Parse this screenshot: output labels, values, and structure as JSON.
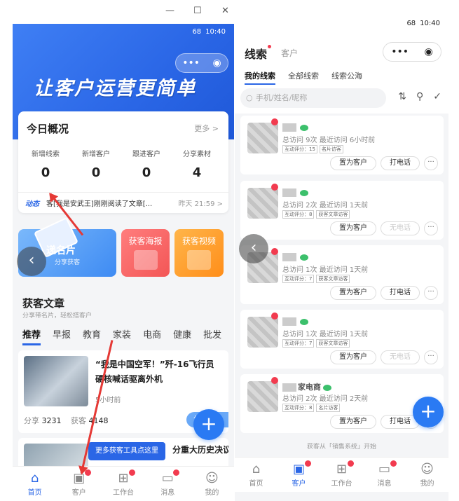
{
  "window": {
    "minimize": "—",
    "maximize": "☐",
    "close": "✕"
  },
  "left": {
    "status_time": "10:40",
    "status_battery": "68",
    "capsule": {
      "more": "•••",
      "target": "◉"
    },
    "slogan": "让客户运营更简单",
    "overview": {
      "title": "今日概况",
      "more": "更多 >",
      "stats": [
        {
          "label": "新增线索",
          "value": "0"
        },
        {
          "label": "新增客户",
          "value": "0"
        },
        {
          "label": "跟进客户",
          "value": "0"
        },
        {
          "label": "分享素材",
          "value": "4"
        }
      ],
      "feed_tag": "动态",
      "feed_text": "客[我是安武王]刚刚阅读了文章[...",
      "feed_time": "昨天 21:59 >"
    },
    "tiles": {
      "card_title": "递名片",
      "card_sub": "分享获客",
      "poster": "获客海报",
      "video": "获客视频"
    },
    "section": {
      "title": "获客文章",
      "subtitle": "分享带名片，轻松搭客户"
    },
    "tabs": [
      "推荐",
      "早报",
      "教育",
      "家装",
      "电商",
      "健康",
      "批发"
    ],
    "article": {
      "title": "“我是中国空军！”歼-16飞行员硬核喊话驱离外机",
      "time": "5小时前",
      "share_label": "分享",
      "share_count": "3231",
      "get_label": "获客",
      "get_count": "4148",
      "share_btn": "分享"
    },
    "article2_title": "分重大历史决议",
    "tooltip": "更多获客工具点这里",
    "nav": [
      {
        "icon": "⌂",
        "label": "首页"
      },
      {
        "icon": "▣",
        "label": "客户"
      },
      {
        "icon": "⊞",
        "label": "工作台"
      },
      {
        "icon": "▭",
        "label": "消息"
      },
      {
        "icon": "☺",
        "label": "我的"
      }
    ]
  },
  "right": {
    "status_time": "10:40",
    "status_battery": "68",
    "title": "线索",
    "title2": "客户",
    "capsule": {
      "more": "•••",
      "target": "◉"
    },
    "tabs": [
      "我的线索",
      "全部线索",
      "线索公海"
    ],
    "search_placeholder": "手机/姓名/昵称",
    "tools": {
      "sort": "⇅",
      "filter": "⚲",
      "check": "✓"
    },
    "leads": [
      {
        "name": "",
        "visits": "总访问 9次",
        "last": "最近访问 6小时前",
        "chips": [
          "互动评分：15",
          "名片访客"
        ],
        "set_btn": "置为客户",
        "call_btn": "打电话",
        "call_disabled": false,
        "more": "···"
      },
      {
        "name": "",
        "visits": "总访问 2次",
        "last": "最近访问 1天前",
        "chips": [
          "互动评分：8",
          "获客文章访客"
        ],
        "set_btn": "置为客户",
        "call_btn": "无电话",
        "call_disabled": true,
        "more": "···"
      },
      {
        "name": "",
        "visits": "总访问 1次",
        "last": "最近访问 1天前",
        "chips": [
          "互动评分：7",
          "获客文章访客"
        ],
        "set_btn": "置为客户",
        "call_btn": "打电话",
        "call_disabled": false,
        "more": "···"
      },
      {
        "name": "",
        "visits": "总访问 1次",
        "last": "最近访问 1天前",
        "chips": [
          "互动评分：7",
          "获客文章访客"
        ],
        "set_btn": "置为客户",
        "call_btn": "无电话",
        "call_disabled": true,
        "more": "···"
      },
      {
        "name": "家电商",
        "visits": "总访问 2次",
        "last": "最近访问 2天前",
        "chips": [
          "互动评分：8",
          "名片访客"
        ],
        "set_btn": "置为客户",
        "call_btn": "打电话",
        "call_disabled": false,
        "more": "···"
      }
    ],
    "footnote": "获客从「销售系统」开始",
    "nav": [
      {
        "icon": "⌂",
        "label": "首页"
      },
      {
        "icon": "▣",
        "label": "客户"
      },
      {
        "icon": "⊞",
        "label": "工作台"
      },
      {
        "icon": "▭",
        "label": "消息"
      },
      {
        "icon": "☺",
        "label": "我的"
      }
    ]
  },
  "fab_icon": "+",
  "back_icon": "‹",
  "colors": {
    "accent": "#2a66e6",
    "alert": "#f23b4f",
    "arrow": "#e53935"
  }
}
